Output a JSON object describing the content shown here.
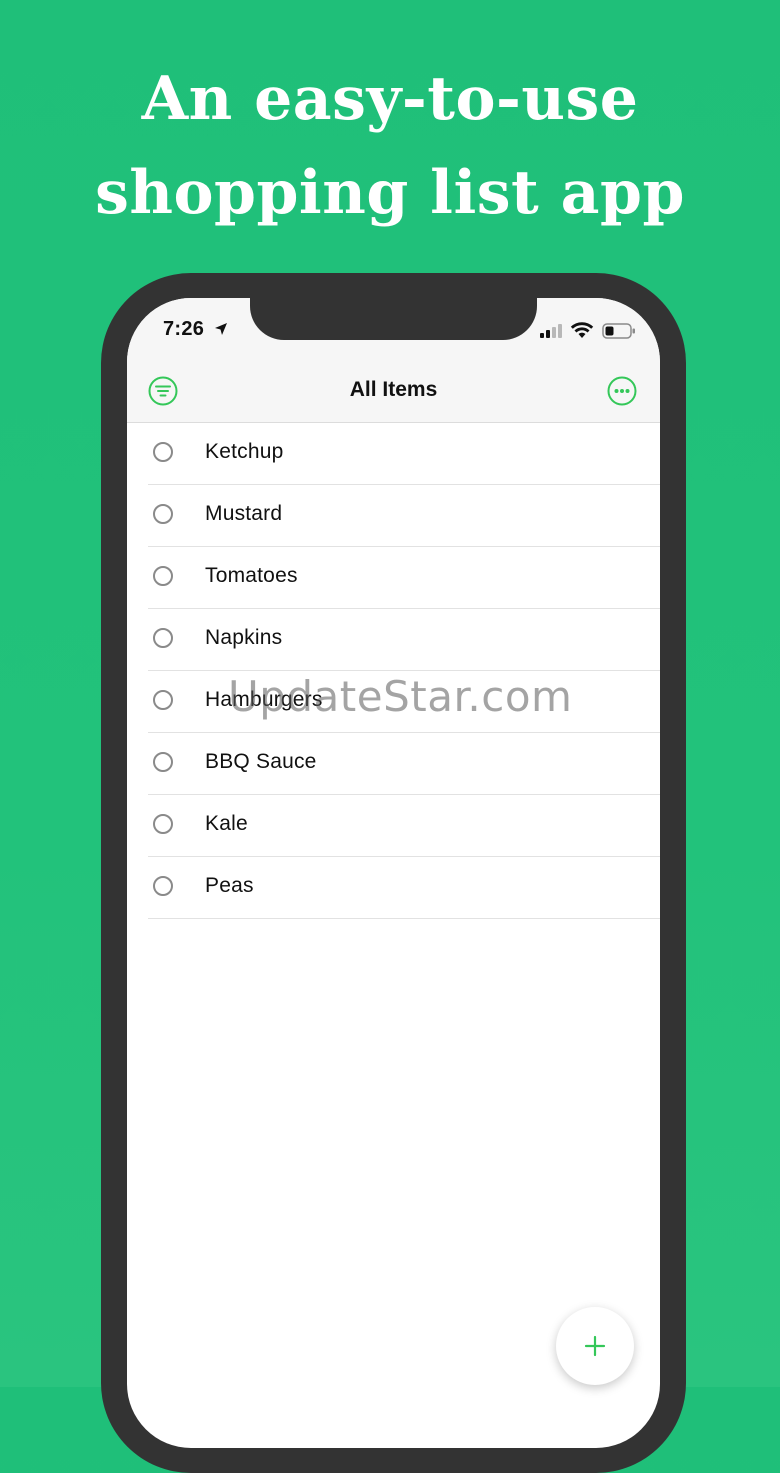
{
  "promo": {
    "headline_line1": "An easy-to-use",
    "headline_line2": "shopping list app",
    "background_color": "#22c27b"
  },
  "status_bar": {
    "time": "7:26",
    "location_icon": "location-arrow-icon",
    "signal_icon": "cellular-signal-icon",
    "wifi_icon": "wifi-icon",
    "battery_icon": "battery-icon"
  },
  "nav": {
    "title": "All Items",
    "left_icon": "filter-icon",
    "right_icon": "more-options-icon",
    "accent_color": "#34c759"
  },
  "items": [
    {
      "label": "Ketchup",
      "checked": false
    },
    {
      "label": "Mustard",
      "checked": false
    },
    {
      "label": "Tomatoes",
      "checked": false
    },
    {
      "label": "Napkins",
      "checked": false
    },
    {
      "label": "Hamburgers",
      "checked": false
    },
    {
      "label": "BBQ Sauce",
      "checked": false
    },
    {
      "label": "Kale",
      "checked": false
    },
    {
      "label": "Peas",
      "checked": false
    }
  ],
  "watermark": "UpdateStar.com",
  "fab": {
    "icon": "plus-icon"
  }
}
